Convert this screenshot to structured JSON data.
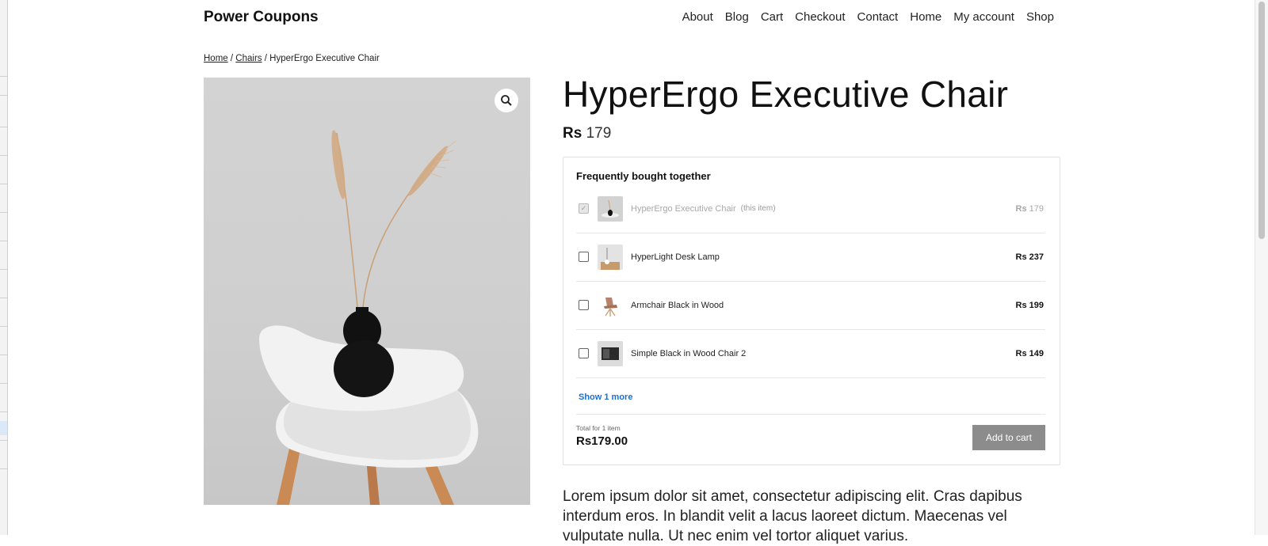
{
  "site": {
    "title": "Power Coupons"
  },
  "nav": {
    "items": [
      "About",
      "Blog",
      "Cart",
      "Checkout",
      "Contact",
      "Home",
      "My account",
      "Shop"
    ]
  },
  "breadcrumb": {
    "home": "Home",
    "category": "Chairs",
    "current": "HyperErgo Executive Chair",
    "sep": "/"
  },
  "product": {
    "title": "HyperErgo Executive Chair",
    "currency": "Rs",
    "price": "179",
    "description": "Lorem ipsum dolor sit amet, consectetur adipiscing elit. Cras dapibus interdum eros. In blandit velit a lacus laoreet dictum. Maecenas vel vulputate nulla. Ut nec enim vel tortor aliquet varius."
  },
  "fbt": {
    "heading": "Frequently bought together",
    "items": [
      {
        "name": "HyperErgo Executive Chair",
        "tag": "(this item)",
        "currency": "Rs",
        "price": "179",
        "checked": true,
        "icon": "vase-chair-thumbnail"
      },
      {
        "name": "HyperLight Desk Lamp",
        "tag": "",
        "currency": "Rs",
        "price": "237",
        "checked": false,
        "icon": "desk-lamp-thumbnail"
      },
      {
        "name": "Armchair Black in Wood",
        "tag": "",
        "currency": "Rs",
        "price": "199",
        "checked": false,
        "icon": "armchair-thumbnail"
      },
      {
        "name": "Simple Black in Wood Chair 2",
        "tag": "",
        "currency": "Rs",
        "price": "149",
        "checked": false,
        "icon": "black-chair-thumbnail"
      }
    ],
    "show_more": "Show 1 more",
    "total_label": "Total for 1 item",
    "total_value": "Rs179.00",
    "add_button": "Add to cart"
  },
  "colors": {
    "link": "#1b6fd3",
    "button": "#8c8c8c",
    "image_bg": "#cfcfcf"
  }
}
